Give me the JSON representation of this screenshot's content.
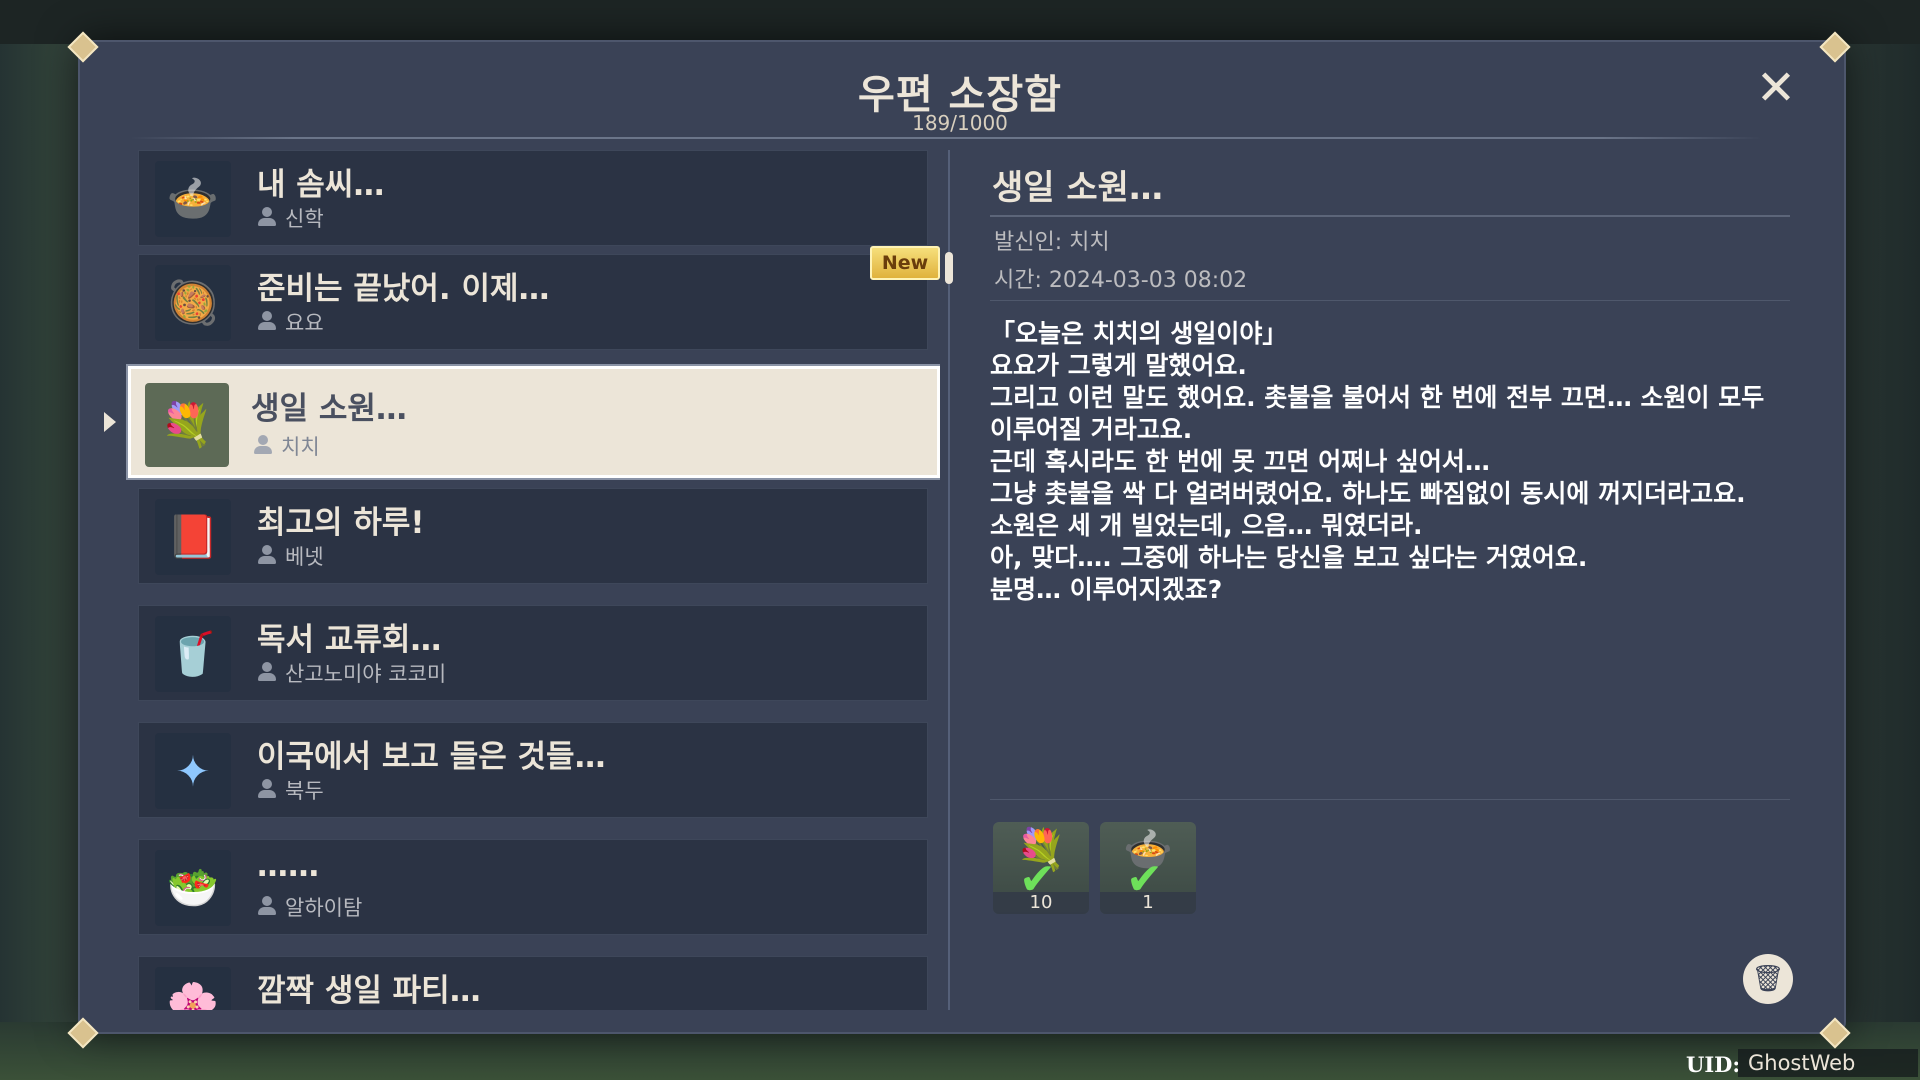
{
  "header": {
    "title": "우편 소장함",
    "count": "189/1000",
    "close_label": "✕"
  },
  "mail_list": {
    "new_badge": "New",
    "items": [
      {
        "title": "내 솜씨…",
        "sender": "신학",
        "icon": "🍲",
        "icon_name": "dish-icon"
      },
      {
        "title": "준비는 끝났어. 이제…",
        "sender": "요요",
        "icon": "🥘",
        "icon_name": "dish-icon"
      },
      {
        "title": "생일 소원…",
        "sender": "치치",
        "icon": "💐",
        "icon_name": "flower-bouquet-icon"
      },
      {
        "title": "최고의 하루!",
        "sender": "베넷",
        "icon": "📕",
        "icon_name": "book-icon"
      },
      {
        "title": "독서 교류회…",
        "sender": "산고노미야 코코미",
        "icon": "🥤",
        "icon_name": "drink-icon"
      },
      {
        "title": "이국에서 보고 들은 것들…",
        "sender": "북두",
        "icon": "✦",
        "icon_name": "star-crystal-icon"
      },
      {
        "title": "……",
        "sender": "알하이탐",
        "icon": "🥗",
        "icon_name": "dish-icon"
      },
      {
        "title": "깜짝 생일 파티…",
        "sender": "",
        "icon": "🌸",
        "icon_name": "flower-icon"
      }
    ]
  },
  "detail": {
    "title": "생일 소원…",
    "sender": "발신인: 치치",
    "time": "시간: 2024-03-03 08:02",
    "body": [
      "「오늘은 치치의 생일이야」",
      "요요가 그렇게 말했어요.",
      "그리고 이런 말도 했어요. 촛불을 불어서 한 번에 전부 끄면… 소원이 모두",
      "이루어질 거라고요.",
      "근데 혹시라도 한 번에 못 끄면 어쩌나 싶어서…",
      "그냥 촛불을 싹 다 얼려버렸어요. 하나도 빠짐없이 동시에 꺼지더라고요.",
      "소원은 세 개 빌었는데, 으음… 뭐였더라.",
      "아, 맞다…. 그중에 하나는 당신을 보고 싶다는 거였어요.",
      "분명… 이루어지겠죠?"
    ],
    "attachments": [
      {
        "icon": "💐",
        "icon_name": "flower-bouquet-icon",
        "count": "10",
        "claimed": true
      },
      {
        "icon": "🍲",
        "icon_name": "dish-icon",
        "count": "1",
        "claimed": true
      }
    ]
  },
  "footer": {
    "uid_label": "UID:",
    "uid_value": "GhostWeb"
  }
}
